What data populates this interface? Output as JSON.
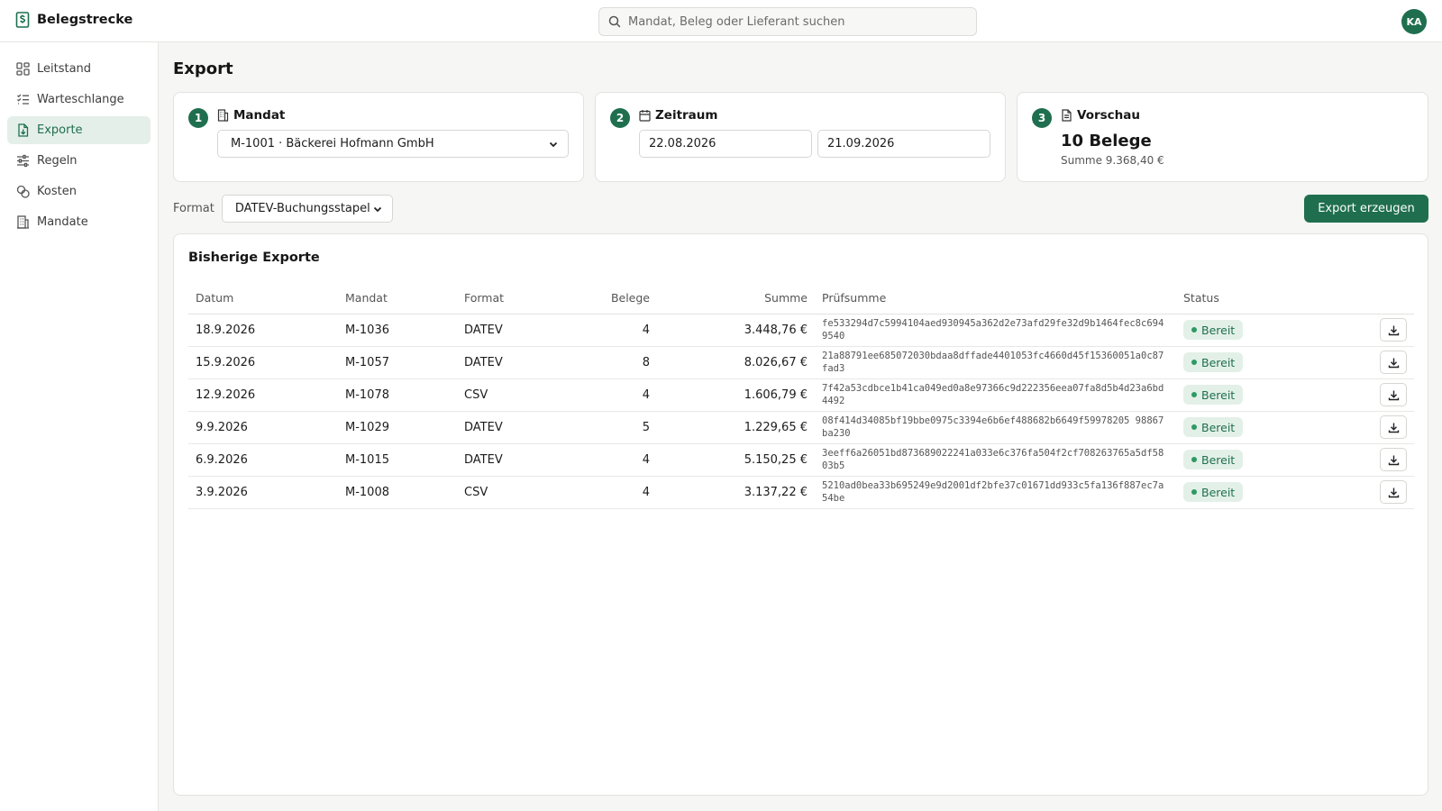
{
  "app": {
    "name": "Belegstrecke",
    "user_initials": "KA"
  },
  "search": {
    "placeholder": "Mandat, Beleg oder Lieferant suchen"
  },
  "sidebar": {
    "items": [
      {
        "label": "Leitstand",
        "icon": "dashboard-icon",
        "active": false
      },
      {
        "label": "Warteschlange",
        "icon": "queue-list-icon",
        "active": false
      },
      {
        "label": "Exporte",
        "icon": "file-export-icon",
        "active": true
      },
      {
        "label": "Regeln",
        "icon": "sliders-icon",
        "active": false
      },
      {
        "label": "Kosten",
        "icon": "coins-icon",
        "active": false
      },
      {
        "label": "Mandate",
        "icon": "building-icon",
        "active": false
      }
    ]
  },
  "page": {
    "title": "Export"
  },
  "steps": {
    "mandat": {
      "number": "1",
      "title": "Mandat",
      "selected": "M-1001 · Bäckerei Hofmann GmbH"
    },
    "zeitraum": {
      "number": "2",
      "title": "Zeitraum",
      "from": "22.08.2026",
      "to": "21.09.2026"
    },
    "vorschau": {
      "number": "3",
      "title": "Vorschau",
      "count": "10 Belege",
      "sum": "Summe 9.368,40 €"
    }
  },
  "format": {
    "label": "Format",
    "selected": "DATEV-Buchungsstapel"
  },
  "actions": {
    "export_label": "Export erzeugen"
  },
  "history": {
    "title": "Bisherige Exporte",
    "columns": [
      "Datum",
      "Mandat",
      "Format",
      "Belege",
      "Summe",
      "Prüfsumme",
      "Status"
    ],
    "rows": [
      {
        "date": "18.9.2026",
        "mandat": "M-1036",
        "format": "DATEV",
        "belege": "4",
        "summe": "3.448,76 €",
        "hash": "fe533294d7c5994104aed930945a362d2e73afd29fe32d9b1464fec8c6949540",
        "status": "Bereit"
      },
      {
        "date": "15.9.2026",
        "mandat": "M-1057",
        "format": "DATEV",
        "belege": "8",
        "summe": "8.026,67 €",
        "hash": "21a88791ee685072030bdaa8dffade4401053fc4660d45f15360051a0c87fad3",
        "status": "Bereit"
      },
      {
        "date": "12.9.2026",
        "mandat": "M-1078",
        "format": "CSV",
        "belege": "4",
        "summe": "1.606,79 €",
        "hash": "7f42a53cdbce1b41ca049ed0a8e97366c9d222356eea07fa8d5b4d23a6bd4492",
        "status": "Bereit"
      },
      {
        "date": "9.9.2026",
        "mandat": "M-1029",
        "format": "DATEV",
        "belege": "5",
        "summe": "1.229,65 €",
        "hash": "08f414d34085bf19bbe0975c3394e6b6ef488682b6649f59978205 98867ba230",
        "status": "Bereit"
      },
      {
        "date": "6.9.2026",
        "mandat": "M-1015",
        "format": "DATEV",
        "belege": "4",
        "summe": "5.150,25 €",
        "hash": "3eeff6a26051bd873689022241a033e6c376fa504f2cf708263765a5df5803b5",
        "status": "Bereit"
      },
      {
        "date": "3.9.2026",
        "mandat": "M-1008",
        "format": "CSV",
        "belege": "4",
        "summe": "3.137,22 €",
        "hash": "5210ad0bea33b695249e9d2001df2bfe37c01671dd933c5fa136f887ec7a54be",
        "status": "Bereit"
      }
    ]
  },
  "colors": {
    "accent": "#1f6f4f",
    "accent_soft": "#e5efe9",
    "badge_bg": "#e3f0e8"
  }
}
